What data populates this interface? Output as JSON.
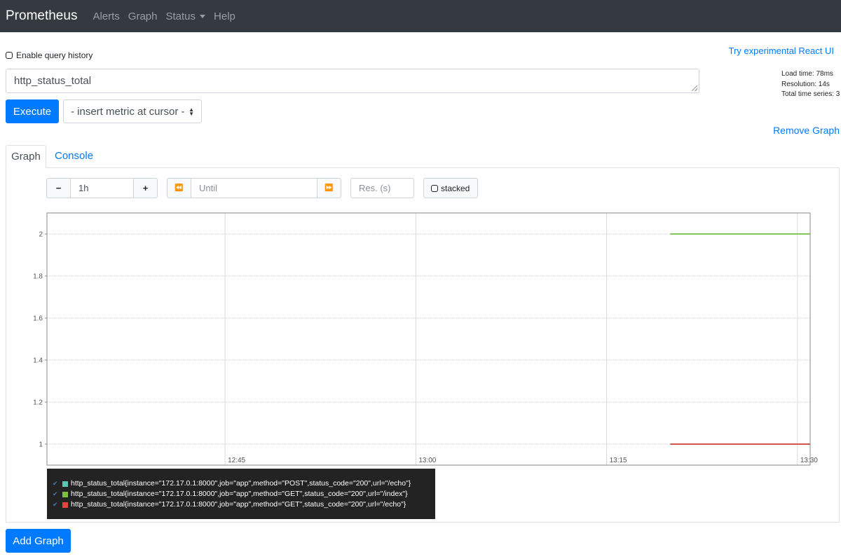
{
  "navbar": {
    "brand": "Prometheus",
    "items": [
      {
        "label": "Alerts"
      },
      {
        "label": "Graph"
      },
      {
        "label": "Status"
      },
      {
        "label": "Help"
      }
    ]
  },
  "query_history_label": "Enable query history",
  "react_ui_link": "Try experimental React UI",
  "stats": {
    "load_time": "Load time: 78ms",
    "resolution": "Resolution: 14s",
    "total_series": "Total time series: 3"
  },
  "expression": "http_status_total",
  "execute_label": "Execute",
  "metric_select": "- insert metric at cursor -",
  "remove_graph_label": "Remove Graph",
  "tabs": [
    {
      "label": "Graph",
      "active": true
    },
    {
      "label": "Console",
      "active": false
    }
  ],
  "controls": {
    "minus": "−",
    "range": "1h",
    "plus": "+",
    "back": "⏪",
    "until_placeholder": "Until",
    "forward": "⏩",
    "res_placeholder": "Res. (s)",
    "stacked_label": "stacked"
  },
  "chart_data": {
    "type": "line",
    "x_ticks": [
      "12:45",
      "13:00",
      "13:15",
      "13:30"
    ],
    "y_ticks": [
      1,
      1.2,
      1.4,
      1.6,
      1.8,
      2
    ],
    "xlim": [
      "12:31",
      "13:31"
    ],
    "ylim": [
      0.9,
      2.1
    ],
    "grid": true,
    "series": [
      {
        "name": "http_status_total{instance=\"172.17.0.1:8000\",job=\"app\",method=\"POST\",status_code=\"200\",url=\"/echo\"}",
        "color": "#5fc3b6",
        "x": [
          "13:20",
          "13:31"
        ],
        "values": [
          1,
          1
        ]
      },
      {
        "name": "http_status_total{instance=\"172.17.0.1:8000\",job=\"app\",method=\"GET\",status_code=\"200\",url=\"/index\"}",
        "color": "#7cc142",
        "x": [
          "13:20",
          "13:31"
        ],
        "values": [
          2,
          2
        ]
      },
      {
        "name": "http_status_total{instance=\"172.17.0.1:8000\",job=\"app\",method=\"GET\",status_code=\"200\",url=\"/echo\"}",
        "color": "#e0483b",
        "x": [
          "13:20",
          "13:31"
        ],
        "values": [
          1,
          1
        ]
      }
    ]
  },
  "add_graph_label": "Add Graph"
}
